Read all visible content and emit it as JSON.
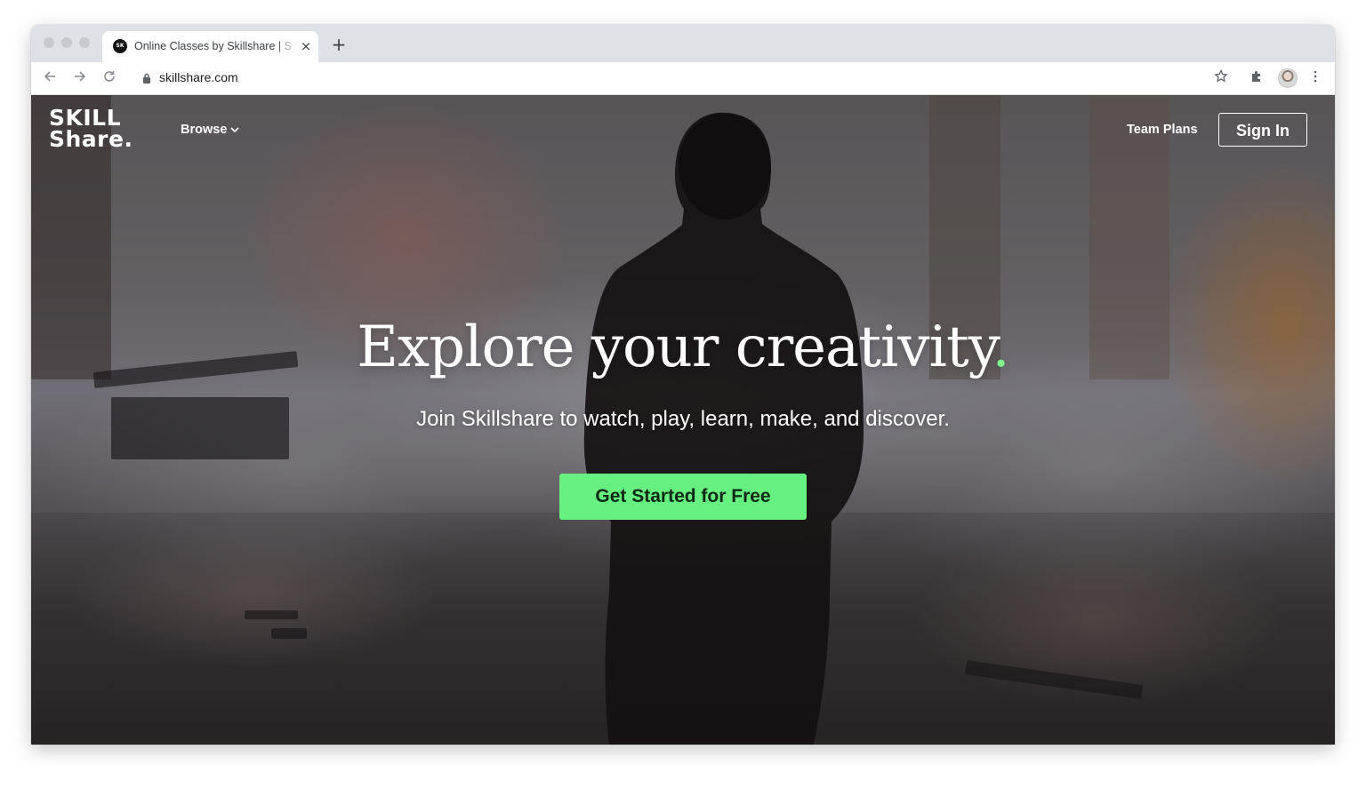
{
  "browser": {
    "tab_title": "Online Classes by Skillshare | S",
    "favicon_text": "SK",
    "url": "skillshare.com",
    "tab_close_glyph": "×",
    "new_tab_glyph": "+"
  },
  "site": {
    "logo_line1": "SKILL",
    "logo_line2": "Share.",
    "nav": {
      "browse_label": "Browse",
      "team_plans_label": "Team Plans",
      "sign_in_label": "Sign In"
    },
    "hero": {
      "title": "Explore your creativity",
      "title_dot": ".",
      "subtitle": "Join Skillshare to watch, play, learn, make, and discover.",
      "cta_label": "Get Started for Free"
    }
  },
  "colors": {
    "accent_green": "#66f080",
    "tab_strip": "#dee1e6",
    "text_white": "#ffffff"
  },
  "icons": {
    "back": "back-arrow-icon",
    "forward": "forward-arrow-icon",
    "reload": "reload-icon",
    "lock": "lock-icon",
    "bookmark": "star-icon",
    "extensions": "puzzle-icon",
    "profile": "avatar",
    "menu": "kebab-menu-icon"
  }
}
